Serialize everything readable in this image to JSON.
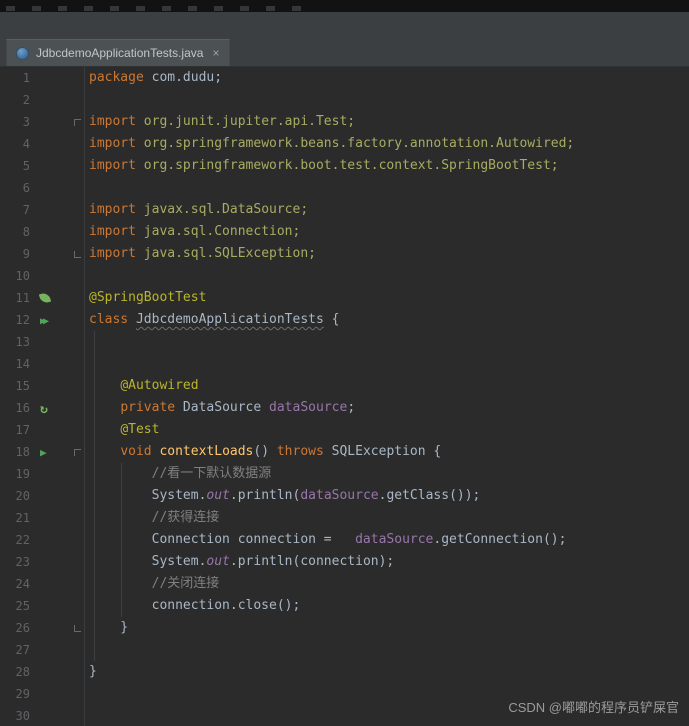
{
  "colors": {
    "editor_background": "#2B2B2B",
    "header_background": "#3C3F41",
    "tab_background": "#4C5254",
    "gutter_text": "#606366",
    "keyword": "#CC7832",
    "plain_text": "#A9B7C6",
    "import_path": "#A8AC61",
    "annotation": "#BBB529",
    "comment": "#808080",
    "field": "#9876AA",
    "method_declaration": "#FFC66B",
    "run_icon_green": "#4FA65A",
    "spring_green": "#77B25F",
    "watermark_text": "#9B9B9B"
  },
  "tab_bar": {
    "active_tab": {
      "label": "JdbcdemoApplicationTests.java",
      "close_glyph": "×",
      "icon": "java-class-icon"
    }
  },
  "editor": {
    "lines": [
      {
        "n": 1,
        "segs": [
          [
            "kw",
            "package"
          ],
          [
            "pl",
            " com.dudu;"
          ]
        ]
      },
      {
        "n": 2,
        "segs": []
      },
      {
        "n": 3,
        "fold": "start",
        "segs": [
          [
            "kw",
            "import"
          ],
          [
            "im",
            " org.junit.jupiter.api.Test;"
          ]
        ]
      },
      {
        "n": 4,
        "segs": [
          [
            "kw",
            "import"
          ],
          [
            "im",
            " org.springframework.beans.factory.annotation.Autowired;"
          ]
        ]
      },
      {
        "n": 5,
        "segs": [
          [
            "kw",
            "import"
          ],
          [
            "im",
            " org.springframework.boot.test.context.SpringBootTest;"
          ]
        ]
      },
      {
        "n": 6,
        "segs": []
      },
      {
        "n": 7,
        "segs": [
          [
            "kw",
            "import"
          ],
          [
            "im",
            " javax.sql.DataSource;"
          ]
        ]
      },
      {
        "n": 8,
        "segs": [
          [
            "kw",
            "import"
          ],
          [
            "im",
            " java.sql.Connection;"
          ]
        ]
      },
      {
        "n": 9,
        "fold": "end",
        "segs": [
          [
            "kw",
            "import"
          ],
          [
            "im",
            " java.sql.SQLException;"
          ]
        ]
      },
      {
        "n": 10,
        "segs": []
      },
      {
        "n": 11,
        "icon": "spring-leaf",
        "segs": [
          [
            "an",
            "@SpringBootTest"
          ]
        ]
      },
      {
        "n": 12,
        "icon": "run-class",
        "segs": [
          [
            "kw",
            "class"
          ],
          [
            "pl",
            " "
          ],
          [
            "cls",
            "JdbcdemoApplicationTests"
          ],
          [
            "pl",
            " {"
          ]
        ]
      },
      {
        "n": 13,
        "segs": []
      },
      {
        "n": 14,
        "segs": []
      },
      {
        "n": 15,
        "segs": [
          [
            "pl",
            "    "
          ],
          [
            "an",
            "@Autowired"
          ]
        ]
      },
      {
        "n": 16,
        "icon": "spring-bean",
        "segs": [
          [
            "pl",
            "    "
          ],
          [
            "kw",
            "private"
          ],
          [
            "pl",
            " DataSource "
          ],
          [
            "fd",
            "dataSource"
          ],
          [
            "pl",
            ";"
          ]
        ]
      },
      {
        "n": 17,
        "segs": [
          [
            "pl",
            "    "
          ],
          [
            "an",
            "@Test"
          ]
        ]
      },
      {
        "n": 18,
        "icon": "run-method",
        "fold": "start",
        "segs": [
          [
            "pl",
            "    "
          ],
          [
            "kw",
            "void"
          ],
          [
            "pl",
            " "
          ],
          [
            "mth",
            "contextLoads"
          ],
          [
            "pl",
            "() "
          ],
          [
            "kw",
            "throws"
          ],
          [
            "pl",
            " SQLException {"
          ]
        ]
      },
      {
        "n": 19,
        "segs": [
          [
            "cm",
            "        //看一下默认数据源"
          ]
        ]
      },
      {
        "n": 20,
        "segs": [
          [
            "pl",
            "        System."
          ],
          [
            "fdI",
            "out"
          ],
          [
            "pl",
            ".println("
          ],
          [
            "fd",
            "dataSource"
          ],
          [
            "pl",
            ".getClass());"
          ]
        ]
      },
      {
        "n": 21,
        "segs": [
          [
            "cm",
            "        //获得连接"
          ]
        ]
      },
      {
        "n": 22,
        "segs": [
          [
            "pl",
            "        Connection connection =   "
          ],
          [
            "fd",
            "dataSource"
          ],
          [
            "pl",
            ".getConnection();"
          ]
        ]
      },
      {
        "n": 23,
        "segs": [
          [
            "pl",
            "        System."
          ],
          [
            "fdI",
            "out"
          ],
          [
            "pl",
            ".println(connection);"
          ]
        ]
      },
      {
        "n": 24,
        "segs": [
          [
            "cm",
            "        //关闭连接"
          ]
        ]
      },
      {
        "n": 25,
        "segs": [
          [
            "pl",
            "        connection.close();"
          ]
        ]
      },
      {
        "n": 26,
        "fold": "end",
        "segs": [
          [
            "pl",
            "    }"
          ]
        ]
      },
      {
        "n": 27,
        "segs": []
      },
      {
        "n": 28,
        "segs": [
          [
            "pl",
            "}"
          ]
        ]
      },
      {
        "n": 29,
        "segs": []
      },
      {
        "n": 30,
        "segs": []
      }
    ]
  },
  "watermark": {
    "text": "CSDN @嘟嘟的程序员铲屎官"
  }
}
